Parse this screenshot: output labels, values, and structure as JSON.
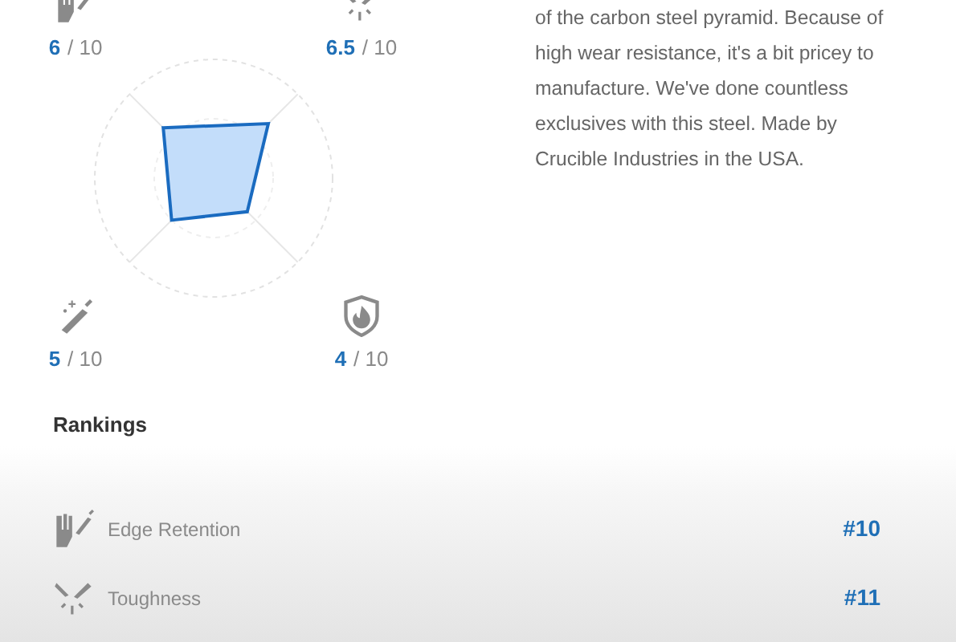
{
  "scores": [
    {
      "kind": "edge",
      "value": "6",
      "max": "/ 10"
    },
    {
      "kind": "toughness",
      "value": "6.5",
      "max": "/ 10"
    },
    {
      "kind": "sharpening",
      "value": "5",
      "max": "/ 10"
    },
    {
      "kind": "corrosion",
      "value": "4",
      "max": "/ 10"
    }
  ],
  "description": "of the carbon steel pyramid. Because of high wear resistance, it's a bit pricey to manufacture. We've done countless exclusives with this steel. Made by Crucible Industries in the USA.",
  "rankings": {
    "title": "Rankings",
    "rows": [
      {
        "kind": "edge",
        "label": "Edge Retention",
        "rank": "#10"
      },
      {
        "kind": "toughness",
        "label": "Toughness",
        "rank": "#11"
      }
    ]
  }
}
